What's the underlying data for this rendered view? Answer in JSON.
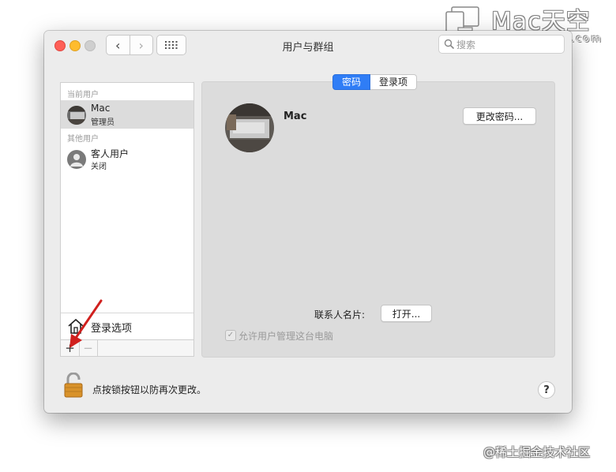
{
  "window": {
    "title": "用户与群组",
    "search_placeholder": "搜索",
    "nav_back": "‹",
    "nav_forward": "›"
  },
  "sidebar": {
    "section_current": "当前用户",
    "section_other": "其他用户",
    "users": [
      {
        "name": "Mac",
        "role": "管理员",
        "selected": true
      },
      {
        "name": "客人用户",
        "role": "关闭",
        "selected": false
      }
    ],
    "login_options_label": "登录选项",
    "add_label": "+",
    "remove_label": "−"
  },
  "tabs": [
    {
      "label": "密码",
      "active": true
    },
    {
      "label": "登录项",
      "active": false
    }
  ],
  "account": {
    "name": "Mac",
    "change_password_label": "更改密码...",
    "contact_card_label": "联系人名片:",
    "open_label": "打开...",
    "allow_admin_label": "允许用户管理这台电脑",
    "allow_admin_checked": true
  },
  "footer": {
    "lock_text": "点按锁按钮以防再次更改。",
    "help_label": "?"
  },
  "watermarks": {
    "brand": "Mac天空",
    "domain": "www.mac69.com",
    "bottom": "@稀土掘金技术社区"
  },
  "colors": {
    "accent": "#2f7df6",
    "window_bg": "#ececec",
    "panel_bg": "#dcdcdc",
    "annotation_arrow": "#d0201e"
  }
}
